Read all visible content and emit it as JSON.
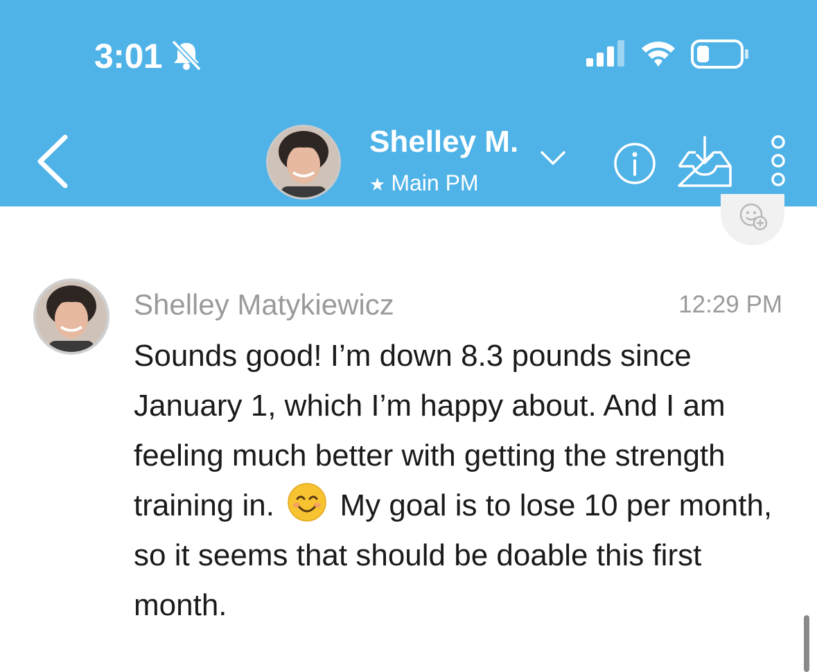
{
  "status_bar": {
    "time": "3:01"
  },
  "header": {
    "contact_name": "Shelley M.",
    "subtitle": "Main PM",
    "background_color": "#4fb3e8",
    "icons": {
      "back": "chevron-left-icon",
      "avatar": "avatar",
      "dropdown": "chevron-down-icon",
      "info": "info-icon",
      "inbox": "inbox-download-icon",
      "more": "more-vertical-icon"
    }
  },
  "message": {
    "sender": "Shelley Matykiewicz",
    "time": "12:29 PM",
    "text_before_emoji": "Sounds good!  I’m down 8.3 pounds since January 1, which I’m happy about. And I am feeling much better with getting the strength training in.",
    "emoji": "smiling-face-icon",
    "text_after_emoji": "My goal is to lose 10 per month, so it seems that should be doable this first month."
  }
}
